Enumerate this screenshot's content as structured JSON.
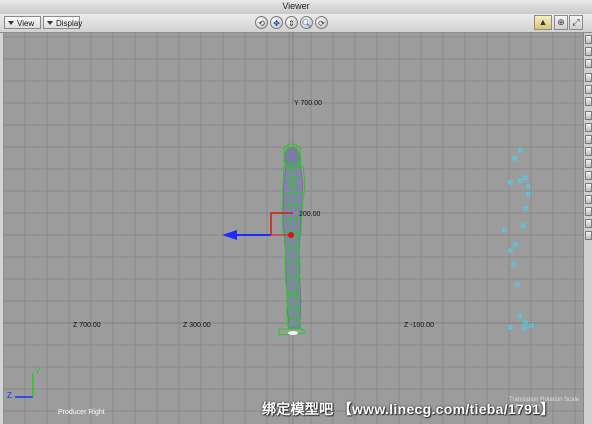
{
  "window": {
    "title": "Viewer"
  },
  "toolbar": {
    "view_label": "View",
    "display_label": "Display",
    "nav_icons": [
      "roll-icon",
      "pan-icon",
      "dolly-icon",
      "zoom-icon",
      "tilt-icon"
    ],
    "right_icons": [
      "camera-icon",
      "zoom-fit-icon",
      "maximize-icon"
    ]
  },
  "viewport": {
    "camera_label": "Producer Right",
    "grid_labels": {
      "top": "Y 700.00",
      "mid": "200.00",
      "bottom_1": "Z 700.00",
      "bottom_2": "Z 300.00",
      "bottom_3": "Z -100.00"
    },
    "axis_labels": {
      "z": "Z",
      "y": "Y"
    },
    "nav_readout": "Translation Rotation Scale manipulator",
    "watermark": "绑定模型吧 【www.linecg.com/tieba/1791】",
    "colors": {
      "background": "#9c9c9c",
      "grid": "#8a8a8a",
      "skeleton": "#22cc22",
      "mesh": "#8a7fb0",
      "markers": "#33ddff",
      "manipulator_blue": "#1a2cff",
      "manipulator_red": "#d01a1a"
    }
  },
  "rightbar": {
    "buttons": [
      "tool-1-icon",
      "tool-2-icon",
      "tool-3-icon",
      "tool-4-icon",
      "tool-5-icon",
      "tool-6-icon",
      "tool-7-icon",
      "tool-8-icon",
      "tool-9-icon",
      "tool-10-icon",
      "tool-11-icon",
      "tool-12-icon",
      "tool-13-icon",
      "tool-14-icon",
      "tool-15-icon",
      "tool-16-icon",
      "tool-17-icon"
    ]
  }
}
